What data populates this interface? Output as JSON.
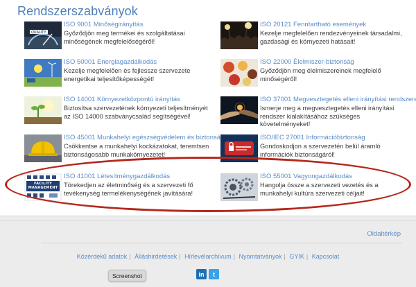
{
  "section_title": "Rendszerszabványok",
  "standards": [
    {
      "title": "ISO 9001 Minőségirányítás",
      "description": "Győződjön meg termékei és szolgáltatásai minőségének megfelelőségéről!",
      "image": "quality-gauge-image"
    },
    {
      "title": "ISO 20121 Fenntartható események",
      "description": "Kezelje megfelelően rendezvényeinek társadalmi, gazdasági és környezeti hatásait!",
      "image": "event-crowd-image"
    },
    {
      "title": "ISO 50001 Energiagazdálkodás",
      "description": "Kezelje megfelelően és fejlessze szervezete energetikai teljesítőképességét!",
      "image": "energy-landscape-image"
    },
    {
      "title": "ISO 22000 Élelmiszer-biztonság",
      "description": "Győződjön meg élelmiszereinek megfelelő minőségéről!",
      "image": "food-plates-image"
    },
    {
      "title": "ISO 14001 Környezetközpontú irányítás",
      "description": "Biztosítsa szervezetének környezeti teljesítményét az ISO 14000 szabványcsalád segítségével!",
      "image": "environment-sprout-image"
    },
    {
      "title": "ISO 37001 Megvesztegetés elleni irányítási rendszerek",
      "description": "Ismerje meg a megvesztegetés elleni irányítási rendszer kialakításához szükséges követelményeket!",
      "image": "handshake-image"
    },
    {
      "title": "ISO 45001 Munkahelyi egészségvédelem és biztonság",
      "description": "Csökkentse a munkahelyi kockázatokat, teremtsen biztonságosabb munkakörnyezetet!",
      "image": "safety-helmet-image"
    },
    {
      "title": "ISO/IEC 27001 Információbiztonság",
      "description": "Gondoskodjon a szervezetén belül áramló információk biztonságáról!",
      "image": "security-lock-image"
    },
    {
      "title": "ISO 41001 Létesítménygazdálkodás",
      "description": "Törekedjen az életminőség és a szervezeti fő tevékenység termelékenységének javítására!",
      "image": "facility-management-image",
      "image_text": "FACILITY MANAGEMENT"
    },
    {
      "title": "ISO 55001 Vagyongazdálkodás",
      "description": "Hangolja össze a szervezeti vezetés és a munkahelyi kultúra szervezeti céljait!",
      "image": "gears-image"
    }
  ],
  "footer": {
    "sitemap": "Oldaltérkép",
    "links": [
      "Közérdekű adatok",
      "Álláshirdetések",
      "Hírlevélarchívum",
      "Nyomtatványok",
      "GYIK",
      "Kapcsolat"
    ],
    "separator": "|",
    "social": [
      {
        "name": "linkedin",
        "glyph": "in"
      },
      {
        "name": "twitter",
        "glyph": "t"
      }
    ]
  },
  "tooltip": "Screenshot",
  "colors": {
    "link": "#5a8cc7",
    "title": "#4f7fb7",
    "highlight": "#b5281c",
    "text": "#3c3c3c"
  }
}
